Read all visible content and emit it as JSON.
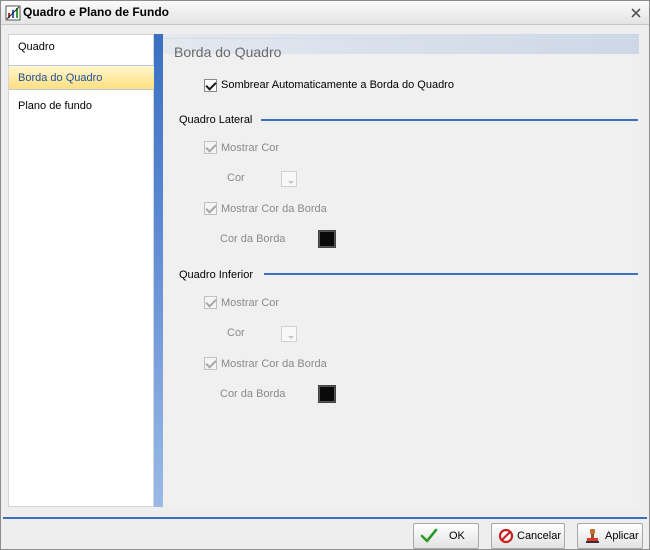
{
  "window": {
    "title": "Quadro e Plano de Fundo"
  },
  "sidebar": {
    "items": [
      {
        "label": "Quadro"
      },
      {
        "label": "Borda do Quadro",
        "selected": true
      },
      {
        "label": "Plano de fundo"
      }
    ]
  },
  "content": {
    "title": "Borda do Quadro",
    "auto_shadow": {
      "label": "Sombrear Automaticamente a Borda do Quadro",
      "checked": true
    },
    "lateral": {
      "header": "Quadro Lateral",
      "show_color": {
        "label": "Mostrar Cor",
        "checked": true
      },
      "color_label": "Cor",
      "show_border_color": {
        "label": "Mostrar Cor da Borda",
        "checked": true
      },
      "border_color_label": "Cor da Borda",
      "border_color": "#0a0a0a"
    },
    "inferior": {
      "header": "Quadro Inferior",
      "show_color": {
        "label": "Mostrar Cor",
        "checked": true
      },
      "color_label": "Cor",
      "show_border_color": {
        "label": "Mostrar Cor da Borda",
        "checked": true
      },
      "border_color_label": "Cor da Borda",
      "border_color": "#0a0a0a"
    }
  },
  "buttons": {
    "ok": "OK",
    "cancel": "Cancelar",
    "apply": "Aplicar"
  },
  "colors": {
    "accent": "#3b6fc1",
    "selected_bg": "#ffe080"
  }
}
